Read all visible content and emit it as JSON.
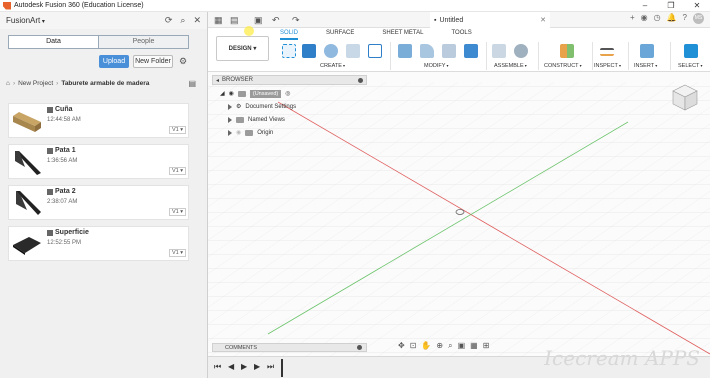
{
  "window": {
    "title": "Autodesk Fusion 360 (Education License)",
    "controls": [
      "–",
      "❐",
      "✕"
    ]
  },
  "data_panel": {
    "team": "FusionArt",
    "tabs": [
      "Data",
      "People"
    ],
    "upload_label": "Upload",
    "new_folder_label": "New Folder",
    "breadcrumb": [
      "New Project",
      "Taburete armable de madera"
    ],
    "files": [
      {
        "name": "Cuña",
        "time": "12:44:58 AM",
        "version": "V1 ▾"
      },
      {
        "name": "Pata 1",
        "time": "1:36:56 AM",
        "version": "V1 ▾"
      },
      {
        "name": "Pata 2",
        "time": "2:38:07 AM",
        "version": "V1 ▾"
      },
      {
        "name": "Superficie",
        "time": "12:52:55 PM",
        "version": "V1 ▾"
      }
    ]
  },
  "document": {
    "tab_title": "Untitled",
    "avatar_initials": "MS"
  },
  "ribbon": {
    "workspace": "DESIGN",
    "tabs": [
      "SOLID",
      "SURFACE",
      "SHEET METAL",
      "TOOLS"
    ],
    "active_tab": "SOLID",
    "groups": [
      "CREATE",
      "MODIFY",
      "ASSEMBLE",
      "CONSTRUCT",
      "INSPECT",
      "INSERT",
      "SELECT"
    ],
    "accent": "#1f8fd6"
  },
  "browser": {
    "title": "BROWSER",
    "root": "(Unsaved)",
    "nodes": [
      "Document Settings",
      "Named Views",
      "Origin"
    ]
  },
  "comments_label": "COMMENTS",
  "watermark": "Icecream APPS"
}
